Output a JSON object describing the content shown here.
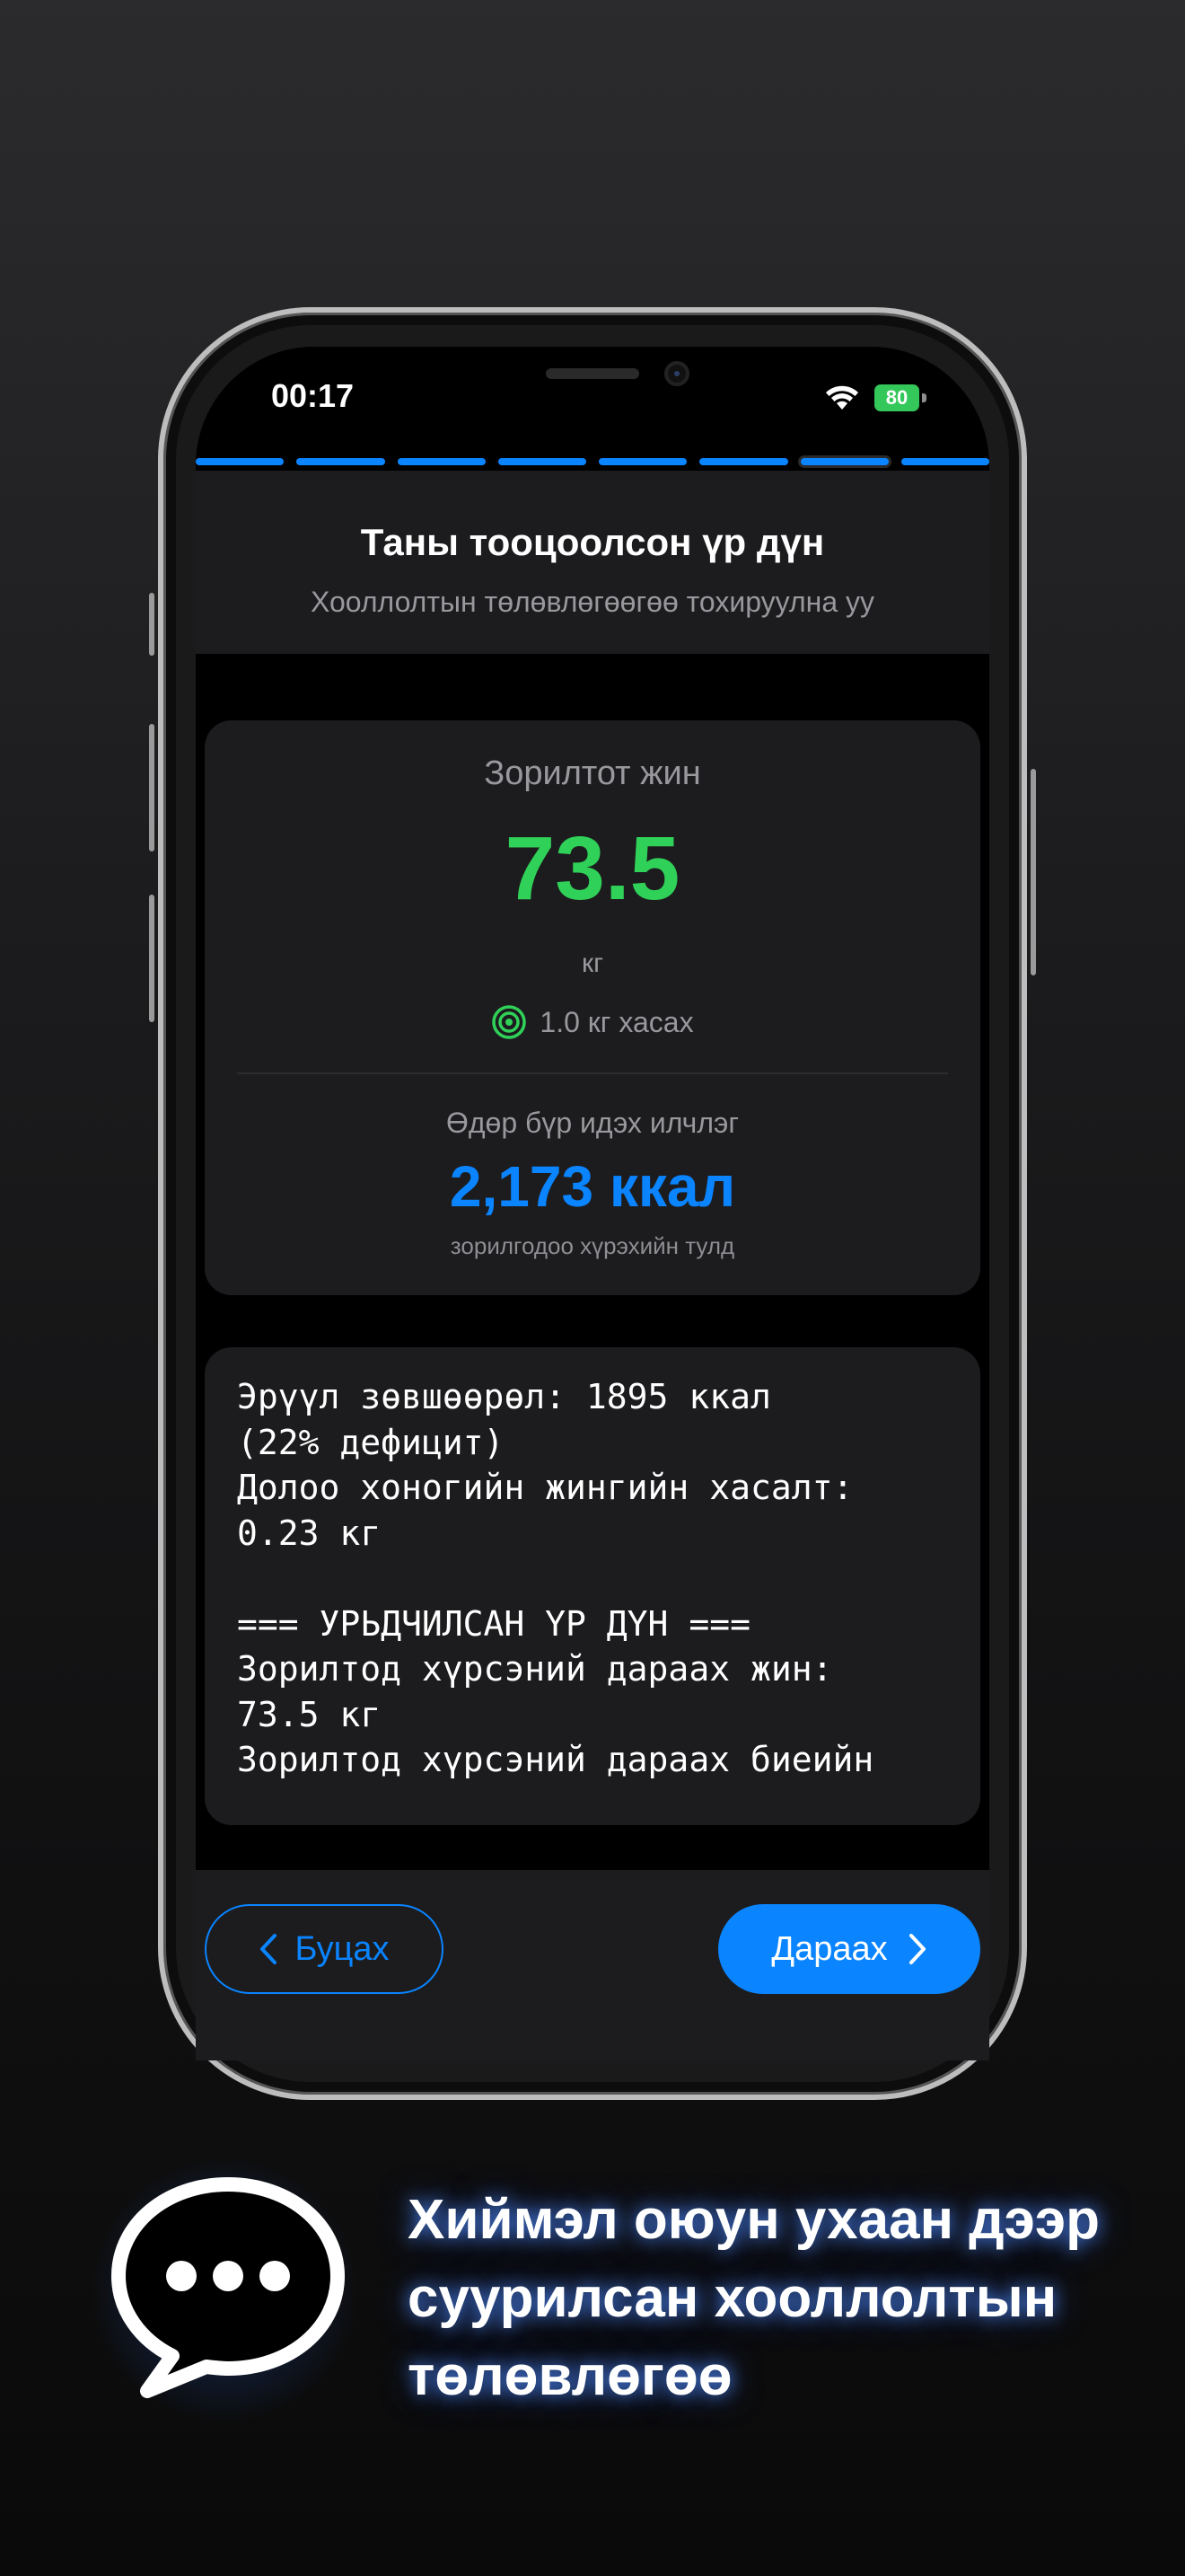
{
  "status_bar": {
    "time": "00:17",
    "battery": "80"
  },
  "progress": {
    "total_steps": 8,
    "current_step": 7
  },
  "header": {
    "title": "Таны тооцоолсон үр дүн",
    "subtitle": "Хооллолтын төлөвлөгөөгөө тохируулна уу"
  },
  "summary": {
    "target_label": "Зорилтот жин",
    "target_value": "73.5",
    "unit": "кг",
    "lose_text": "1.0 кг хасах",
    "daily_label": "Өдөр бүр идэх илчлэг",
    "daily_value": "2,173 ккал",
    "daily_note": "зорилгодоо хүрэхийн тулд"
  },
  "details_text": "Эрүүл зөвшөөрөл: 1895 ккал\n(22% дефицит)\nДолоо хоногийн жингийн хасалт:\n0.23 кг\n\n=== УРЬДЧИЛСАН ҮР ДҮН ===\nЗорилтод хүрсэний дараах жин:\n73.5 кг\nЗорилтод хүрсэний дараах биеийн",
  "nav": {
    "back_label": "Буцах",
    "next_label": "Дараах"
  },
  "promo": {
    "icon": "chat-bubble-icon",
    "line1": "Хиймэл оюун ухаан дээр",
    "line2": "суурилсан хооллолтын",
    "line3": "төлөвлөгөө"
  },
  "colors": {
    "accent": "#0a84ff",
    "success": "#30d158",
    "card": "#1c1c1e"
  }
}
